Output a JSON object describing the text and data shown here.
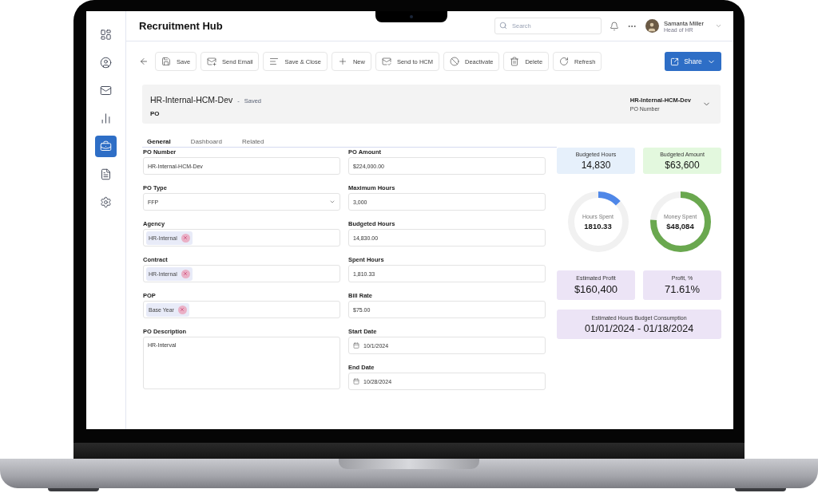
{
  "sidebar": {
    "items": [
      {
        "kind": "dashboard",
        "selected": false
      },
      {
        "kind": "profile",
        "selected": false
      },
      {
        "kind": "mail",
        "selected": false
      },
      {
        "kind": "chart",
        "selected": false
      },
      {
        "kind": "briefcase",
        "selected": true
      },
      {
        "kind": "document",
        "selected": false
      },
      {
        "kind": "settings",
        "selected": false
      }
    ]
  },
  "header": {
    "title": "Recruitment Hub",
    "search": {
      "placeholder": "Search"
    },
    "user": {
      "name": "Samanta Miller",
      "role": "Head of HR"
    }
  },
  "toolbar": {
    "buttons": [
      {
        "kind": "save",
        "label": "Save"
      },
      {
        "kind": "email",
        "label": "Send Email"
      },
      {
        "kind": "close",
        "label": "Save & Close"
      },
      {
        "kind": "new",
        "label": "New"
      },
      {
        "kind": "send",
        "label": "Send to HCM"
      },
      {
        "kind": "deactivate",
        "label": "Deactivate"
      },
      {
        "kind": "delete",
        "label": "Delete"
      },
      {
        "kind": "refresh",
        "label": "Refresh"
      }
    ],
    "share": {
      "label": "Share"
    }
  },
  "record": {
    "name": "HR-Internal-HCM-Dev",
    "separator": "-",
    "status": "Saved",
    "type": "PO",
    "number": "HR-Internal-HCM-Dev",
    "number_label": "PO Number"
  },
  "tabs": [
    {
      "label": "General",
      "selected": true
    },
    {
      "label": "Dashboard",
      "selected": false
    },
    {
      "label": "Related",
      "selected": false
    }
  ],
  "form": {
    "left": [
      {
        "kind": "text",
        "label": "PO Number",
        "value": "HR-Internal-HCM-Dev"
      },
      {
        "kind": "select",
        "label": "PO Type",
        "value": "FFP"
      },
      {
        "kind": "tags",
        "label": "Agency",
        "tags": [
          "HR-Internal"
        ]
      },
      {
        "kind": "tags",
        "label": "Contract",
        "tags": [
          "HR-Internal"
        ]
      },
      {
        "kind": "tags",
        "label": "POP",
        "tags": [
          "Base Year"
        ]
      },
      {
        "kind": "textarea",
        "label": "PO Description",
        "value": "HR-Interval"
      }
    ],
    "right": [
      {
        "kind": "text",
        "label": "PO Amount",
        "value": "$224,000.00"
      },
      {
        "kind": "text",
        "label": "Maximum Hours",
        "value": "3,000"
      },
      {
        "kind": "text",
        "label": "Budgeted Hours",
        "value": "14,830.00"
      },
      {
        "kind": "text",
        "label": "Spent Hours",
        "value": "1,810.33"
      },
      {
        "kind": "text",
        "label": "Bill Rate",
        "value": "$75.00"
      },
      {
        "kind": "date",
        "label": "Start Date",
        "value": "10/1/2024"
      },
      {
        "kind": "date",
        "label": "End Date",
        "value": "10/28/2024"
      }
    ]
  },
  "dashboard": {
    "top": [
      {
        "label": "Budgeted Hours",
        "value": "14,830",
        "color": "#e6f0fb"
      },
      {
        "label": "Budgeted Amount",
        "value": "$63,600",
        "color": "#e3f8de"
      }
    ],
    "meters": [
      {
        "label": "Hours Spent",
        "value": "1810.33",
        "level": 0.13,
        "color": "#4f87e8"
      },
      {
        "label": "Money Spent",
        "value": "$48,084",
        "level": 0.76,
        "color": "#6aa84f"
      }
    ],
    "bottom": [
      {
        "label": "Estimated Profit",
        "value": "$160,400",
        "color": "#ece4f6"
      },
      {
        "label": "Profit, %",
        "value": "71.61%",
        "color": "#ece4f6"
      }
    ],
    "consumption": {
      "label": "Estimated Hours Budget Consumption",
      "value": "01/01/2024 - 01/18/2024",
      "color": "#ece4f6"
    }
  }
}
